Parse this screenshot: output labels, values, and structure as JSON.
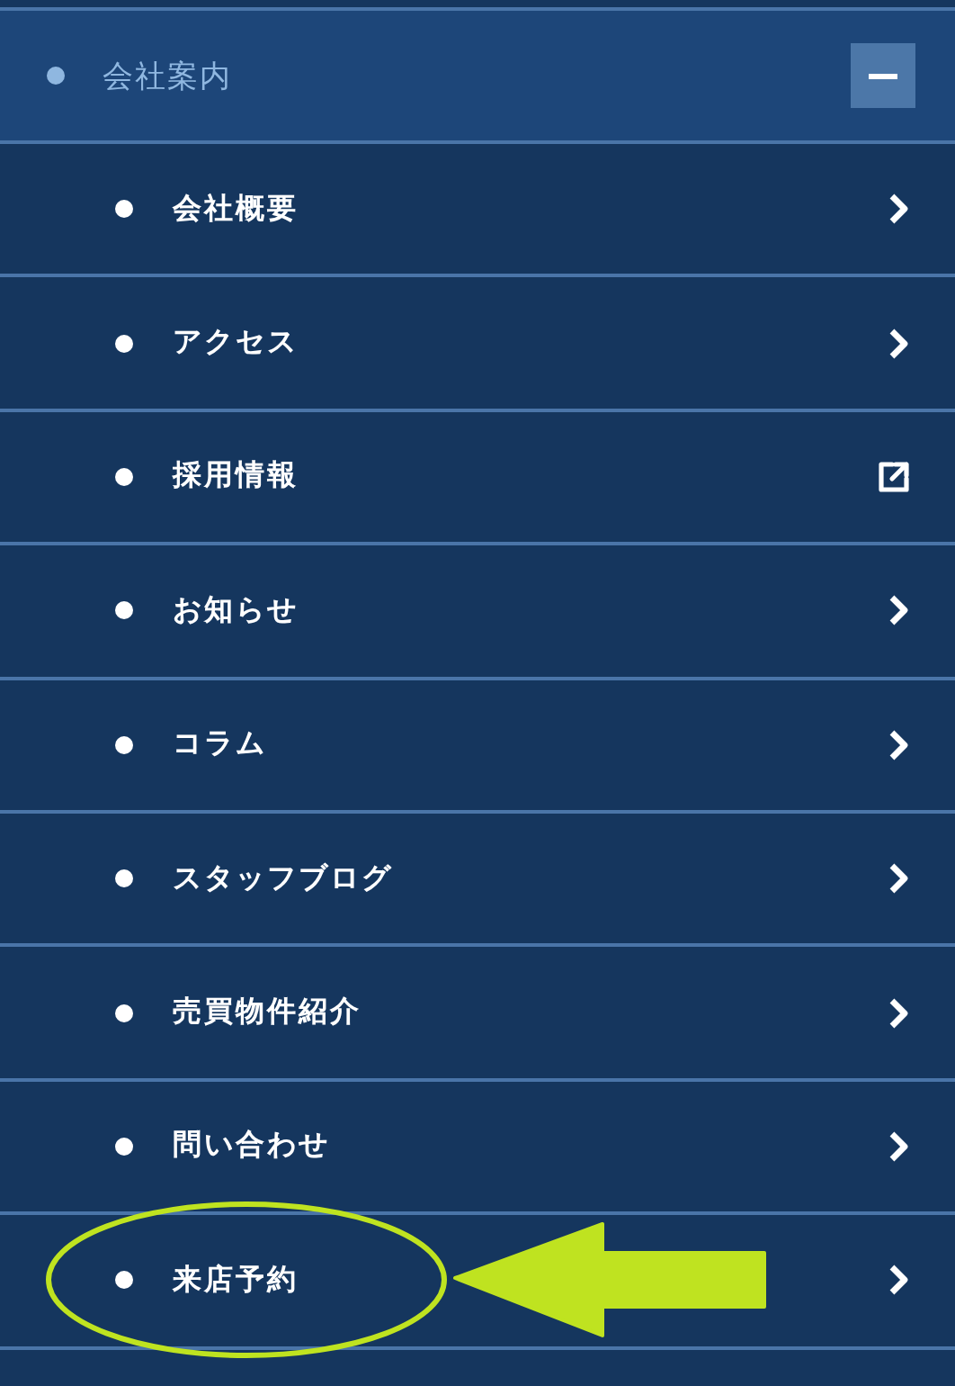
{
  "menu": {
    "header": {
      "label": "会社案内",
      "expanded": true
    },
    "items": [
      {
        "label": "会社概要",
        "kind": "link",
        "highlighted": false
      },
      {
        "label": "アクセス",
        "kind": "link",
        "highlighted": false
      },
      {
        "label": "採用情報",
        "kind": "external",
        "highlighted": false
      },
      {
        "label": "お知らせ",
        "kind": "link",
        "highlighted": false
      },
      {
        "label": "コラム",
        "kind": "link",
        "highlighted": false
      },
      {
        "label": "スタッフブログ",
        "kind": "link",
        "highlighted": false
      },
      {
        "label": "売買物件紹介",
        "kind": "link",
        "highlighted": false
      },
      {
        "label": "問い合わせ",
        "kind": "link",
        "highlighted": false
      },
      {
        "label": "来店予約",
        "kind": "link",
        "highlighted": true
      }
    ]
  }
}
